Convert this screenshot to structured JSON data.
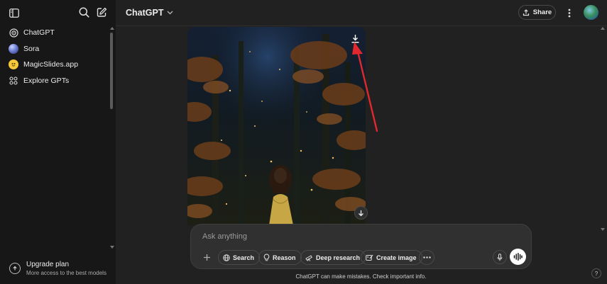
{
  "sidebar": {
    "toggle_icon": "sidebar-toggle-icon",
    "search_icon": "search-icon",
    "new_chat_icon": "new-chat-icon",
    "items": [
      {
        "label": "ChatGPT",
        "icon": "chatgpt-logo-icon"
      },
      {
        "label": "Sora",
        "icon": "sora-icon"
      },
      {
        "label": "MagicSlides.app",
        "icon": "magicslides-icon"
      },
      {
        "label": "Explore GPTs",
        "icon": "grid-icon"
      }
    ],
    "upgrade": {
      "title": "Upgrade plan",
      "subtitle": "More access to the best models",
      "icon": "upgrade-icon"
    }
  },
  "header": {
    "model_label": "ChatGPT",
    "share_label": "Share",
    "share_icon": "share-icon",
    "more_icon": "kebab-menu-icon",
    "avatar_icon": "user-avatar"
  },
  "conversation": {
    "image_icon": "generated-image",
    "download_icon": "download-icon",
    "scroll_down_icon": "arrow-down-icon",
    "annotation_color": "#e0282e"
  },
  "composer": {
    "placeholder": "Ask anything",
    "tools": [
      {
        "label": "Search",
        "icon": "globe-icon"
      },
      {
        "label": "Reason",
        "icon": "lightbulb-icon"
      },
      {
        "label": "Deep research",
        "icon": "telescope-icon"
      },
      {
        "label": "Create image",
        "icon": "image-brush-icon"
      }
    ],
    "more_icon": "more-horizontal-icon",
    "mic_icon": "microphone-icon",
    "voice_icon": "voice-mode-icon"
  },
  "footer": {
    "disclaimer": "ChatGPT can make mistakes. Check important info.",
    "help_label": "?"
  },
  "colors": {
    "background": "#212121",
    "sidebar": "#171717",
    "composer": "#303030",
    "text": "#ececec"
  }
}
